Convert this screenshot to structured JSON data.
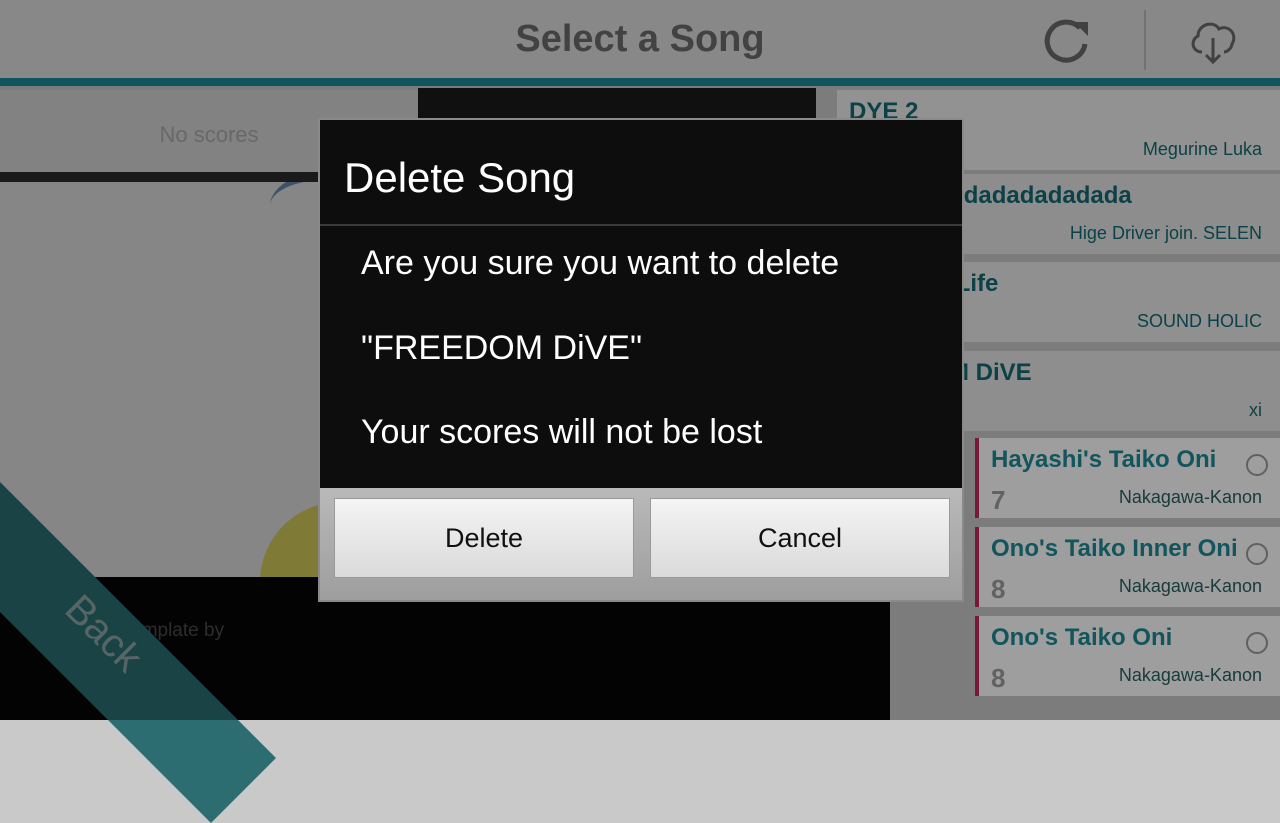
{
  "header": {
    "title": "Select a Song",
    "refresh_icon": "refresh-icon",
    "download_icon": "cloud-download-icon"
  },
  "left_panel": {
    "scores_text": "No scores",
    "credit_text": "d template by",
    "credit_logo": "o"
  },
  "back": {
    "label": "Back"
  },
  "songs": [
    {
      "title": "DYE 2",
      "artist": "Megurine Luka",
      "level": "",
      "bright": false
    },
    {
      "title": "Dadadadadadadadadada",
      "artist": "Hige Driver join. SELEN",
      "level": "",
      "bright": false
    },
    {
      "title": "Drive My Life",
      "artist": "SOUND HOLIC",
      "level": "",
      "bright": false
    },
    {
      "title": "FREEDOM DiVE",
      "artist": "xi",
      "level": "",
      "bright": false
    },
    {
      "title": "Hayashi's Taiko Oni",
      "artist": "Nakagawa-Kanon",
      "level": "7",
      "bright": true
    },
    {
      "title": "Ono's Taiko Inner Oni",
      "artist": "Nakagawa-Kanon",
      "level": "8",
      "bright": true
    },
    {
      "title": "Ono's Taiko Oni",
      "artist": "Nakagawa-Kanon",
      "level": "8",
      "bright": true
    }
  ],
  "dialog": {
    "title": "Delete Song",
    "line1": "Are you sure you want to delete",
    "line2": "\"FREEDOM DiVE\"",
    "line3": "Your scores will not be lost",
    "delete_label": "Delete",
    "cancel_label": "Cancel"
  },
  "colors": {
    "accent": "#1a8a96",
    "song_title": "#1d8a95",
    "dialog_bg": "#0d0d0d"
  }
}
